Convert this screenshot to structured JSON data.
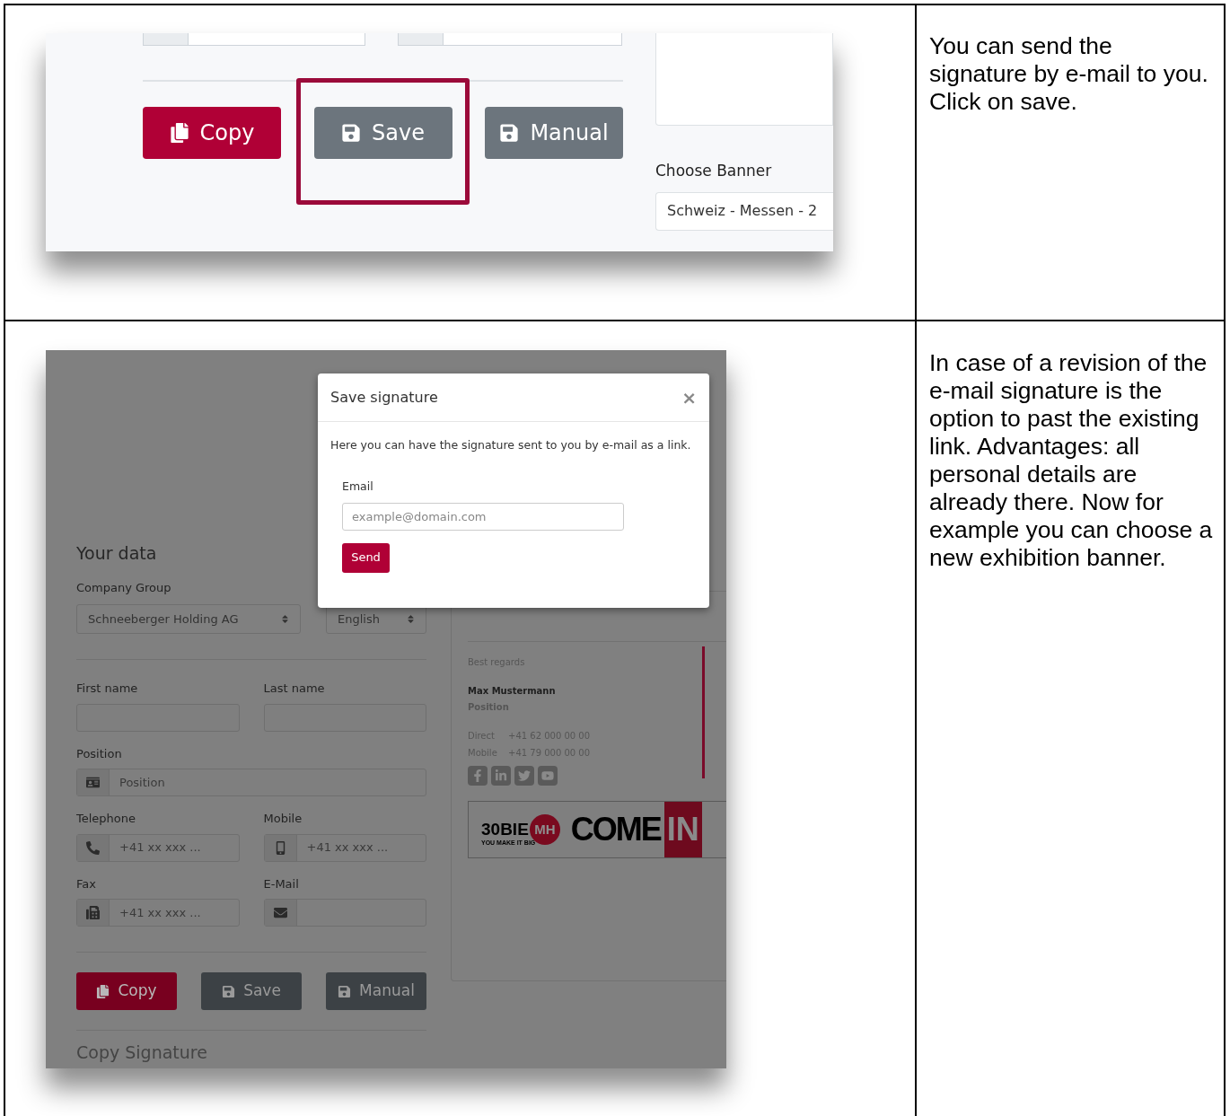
{
  "step_save": {
    "screenshot": {
      "buttons": [
        {
          "label": "Copy",
          "kind": "copy",
          "highlighted": false
        },
        {
          "label": "Save",
          "kind": "save",
          "highlighted": true
        },
        {
          "label": "Manual",
          "kind": "manual",
          "highlighted": false
        }
      ],
      "banner_label": "Choose Banner",
      "banner_value": "Schweiz - Messen - 2"
    },
    "note": "You can send the signature by e-mail to you. Click on save."
  },
  "step_dialog": {
    "screenshot": {
      "form": {
        "heading": "Your data",
        "company_label": "Company Group",
        "company_value": "Schneeberger Holding AG",
        "language_value": "English",
        "field_rows": [
          [
            {
              "label": "First name",
              "kind": "plain"
            },
            {
              "label": "Last name",
              "kind": "plain"
            }
          ],
          [
            {
              "label": "Position",
              "kind": "position",
              "placeholder": "Position"
            }
          ],
          [
            {
              "label": "Telephone",
              "kind": "telephone",
              "placeholder": "+41 xx xxx ..."
            },
            {
              "label": "Mobile",
              "kind": "mobile",
              "placeholder": "+41 xx xxx ..."
            }
          ],
          [
            {
              "label": "Fax",
              "kind": "fax",
              "placeholder": "+41 xx xxx ..."
            },
            {
              "label": "E-Mail",
              "kind": "email"
            }
          ]
        ],
        "buttons": [
          {
            "label": "Copy",
            "kind": "copy",
            "highlighted": false
          },
          {
            "label": "Save",
            "kind": "save",
            "highlighted": false
          },
          {
            "label": "Manual",
            "kind": "manual",
            "highlighted": false
          }
        ],
        "section_title": "Copy Signature"
      },
      "preview": {
        "greeting": "Best regards",
        "name": "Max Mustermann",
        "position": "Position",
        "contacts": [
          {
            "label": "Direct",
            "value": "+41 62 000 00 00"
          },
          {
            "label": "Mobile",
            "value": "+41 79 000 00 00"
          }
        ],
        "social": [
          {
            "kind": "facebook"
          },
          {
            "kind": "linkedin"
          },
          {
            "kind": "twitter"
          },
          {
            "kind": "youtube"
          }
        ],
        "banner": {
          "logo_number": "30BIE",
          "logo_badge": "MH",
          "logo_tagline": "YOU MAKE IT BIG",
          "headline": "COME",
          "headline_highlight": "IN"
        }
      },
      "dialog": {
        "title": "Save signature",
        "close": "×",
        "text": "Here you can have the signature sent to you by e-mail as a link.",
        "email_label": "Email",
        "email_placeholder": "example@domain.com",
        "send": "Send"
      }
    },
    "note": "In case of a revision of the e-mail signature is the option to past the existing link. Advantages: all personal details are already there. Now for example you can choose a new exhibition banner."
  }
}
